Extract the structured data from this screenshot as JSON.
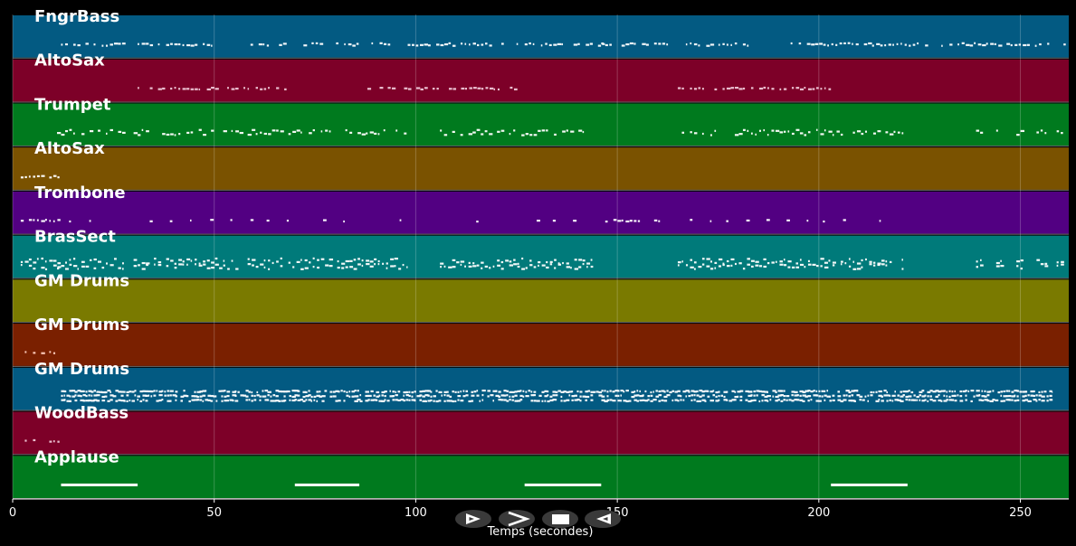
{
  "app": {
    "view": "piano-roll timeline",
    "background_color": "#000000"
  },
  "timeline": {
    "x_range": [
      0,
      262
    ],
    "ticks": [
      0,
      50,
      100,
      150,
      200,
      250
    ],
    "tick_labels": [
      "0",
      "50",
      "100",
      "150",
      "200",
      "250"
    ],
    "xlabel": "Temps (secondes)",
    "grid": true
  },
  "tracks": [
    {
      "name": "FngrBass",
      "color": "#035a82",
      "note_color": "#ffffff",
      "segments": [
        [
          12,
          28
        ],
        [
          31,
          50
        ],
        [
          59,
          86
        ],
        [
          88,
          95
        ],
        [
          98,
          122
        ],
        [
          125,
          147
        ],
        [
          146,
          163
        ],
        [
          166,
          183
        ],
        [
          193,
          262
        ]
      ]
    },
    {
      "name": "AltoSax",
      "color": "#7d0028",
      "note_color": "#f0c8d8",
      "segments": [
        [
          31,
          68
        ],
        [
          88,
          126
        ],
        [
          165,
          203
        ]
      ]
    },
    {
      "name": "Trumpet",
      "color": "#007a1e",
      "note_color": "#ffffff",
      "segments": [
        [
          11,
          28
        ],
        [
          30,
          91
        ],
        [
          92,
          98
        ],
        [
          106,
          144
        ],
        [
          165,
          221
        ],
        [
          239,
          241
        ],
        [
          244,
          246
        ],
        [
          249,
          251
        ],
        [
          254,
          257
        ],
        [
          259,
          261
        ]
      ]
    },
    {
      "name": "AltoSax",
      "color": "#7a5200",
      "note_color": "#ffffff",
      "segments": [
        [
          2,
          12
        ]
      ]
    },
    {
      "name": "Trombone",
      "color": "#520082",
      "note_color": "#ffffff",
      "segments": [
        [
          2,
          12
        ],
        [
          14,
          15
        ],
        [
          19,
          20
        ],
        [
          24,
          25
        ],
        [
          34,
          35
        ],
        [
          39,
          40
        ],
        [
          44,
          45
        ],
        [
          49,
          50
        ],
        [
          54,
          55
        ],
        [
          59,
          60
        ],
        [
          63,
          64
        ],
        [
          68,
          69
        ],
        [
          73,
          74
        ],
        [
          77,
          78
        ],
        [
          82,
          83
        ],
        [
          92,
          93
        ],
        [
          96,
          97
        ],
        [
          111,
          112
        ],
        [
          115,
          116
        ],
        [
          120,
          121
        ],
        [
          125,
          126
        ],
        [
          130,
          131
        ],
        [
          134,
          135
        ],
        [
          139,
          140
        ],
        [
          146,
          162
        ],
        [
          168,
          169
        ],
        [
          173,
          174
        ],
        [
          177,
          178
        ],
        [
          182,
          183
        ],
        [
          187,
          188
        ],
        [
          192,
          193
        ],
        [
          197,
          198
        ],
        [
          201,
          202
        ],
        [
          206,
          207
        ],
        [
          211,
          212
        ],
        [
          215,
          216
        ]
      ]
    },
    {
      "name": "BrasSect",
      "color": "#007a7a",
      "note_color": "#ffffff",
      "segments": [
        [
          2,
          12
        ],
        [
          11,
          28
        ],
        [
          30,
          98
        ],
        [
          106,
          144
        ],
        [
          165,
          221
        ],
        [
          239,
          241
        ],
        [
          244,
          246
        ],
        [
          249,
          251
        ],
        [
          254,
          257
        ],
        [
          259,
          261
        ]
      ]
    },
    {
      "name": "GM Drums",
      "color": "#7a7a00",
      "note_color": "#ffffff",
      "segments": [
        [
          0,
          1
        ]
      ]
    },
    {
      "name": "GM Drums",
      "color": "#7a2000",
      "note_color": "#ffd0c0",
      "segments": [
        [
          2,
          11
        ]
      ]
    },
    {
      "name": "GM Drums",
      "color": "#035a82",
      "note_color": "#ffffff",
      "segments": [
        [
          12,
          258
        ]
      ]
    },
    {
      "name": "WoodBass",
      "color": "#7d0028",
      "note_color": "#f0c8d8",
      "segments": [
        [
          2,
          12
        ]
      ]
    },
    {
      "name": "Applause",
      "color": "#007a1e",
      "note_color": "#ffffff",
      "segments": [
        [
          12,
          31
        ],
        [
          70,
          86
        ],
        [
          127,
          146
        ],
        [
          203,
          222
        ]
      ]
    }
  ],
  "controls": [
    {
      "name": "play-button",
      "icon": "play-outline-icon"
    },
    {
      "name": "forward-button",
      "icon": "chevron-right-icon"
    },
    {
      "name": "stop-button",
      "icon": "stop-square-icon"
    },
    {
      "name": "rewind-button",
      "icon": "play-reverse-outline-icon"
    }
  ]
}
